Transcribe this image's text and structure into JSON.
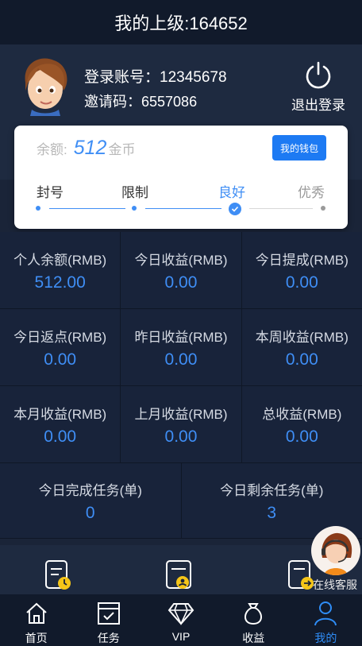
{
  "header": {
    "title": "我的上级:164652"
  },
  "profile": {
    "account": "登录账号：12345678",
    "invite": "邀请码：6557086",
    "logout_label": "退出登录"
  },
  "wallet": {
    "balance_label": "余额:",
    "balance_value": "512",
    "unit": "金币",
    "button_label": "我的钱包"
  },
  "levels": {
    "items": [
      "封号",
      "限制",
      "良好",
      "优秀"
    ],
    "current": "良好"
  },
  "stats": [
    {
      "label": "个人余额(RMB)",
      "value": "512.00"
    },
    {
      "label": "今日收益(RMB)",
      "value": "0.00"
    },
    {
      "label": "今日提成(RMB)",
      "value": "0.00"
    },
    {
      "label": "今日返点(RMB)",
      "value": "0.00"
    },
    {
      "label": "昨日收益(RMB)",
      "value": "0.00"
    },
    {
      "label": "本周收益(RMB)",
      "value": "0.00"
    },
    {
      "label": "本月收益(RMB)",
      "value": "0.00"
    },
    {
      "label": "上月收益(RMB)",
      "value": "0.00"
    },
    {
      "label": "总收益(RMB)",
      "value": "0.00"
    }
  ],
  "task_stats": [
    {
      "label": "今日完成任务(单)",
      "value": "0"
    },
    {
      "label": "今日剩余任务(单)",
      "value": "3"
    }
  ],
  "task_icons": [
    "task-clock-icon",
    "task-user-icon",
    "task-arrow-icon"
  ],
  "service": {
    "label": "在线客服"
  },
  "tabbar": {
    "items": [
      {
        "label": "首页",
        "icon": "home-icon"
      },
      {
        "label": "任务",
        "icon": "task-icon"
      },
      {
        "label": "VIP",
        "icon": "diamond-icon"
      },
      {
        "label": "收益",
        "icon": "money-bag-icon"
      },
      {
        "label": "我的",
        "icon": "user-icon"
      }
    ],
    "active": "我的"
  },
  "colors": {
    "accent": "#3f8ef5",
    "background": "#1a2438",
    "header": "#111a2b"
  }
}
